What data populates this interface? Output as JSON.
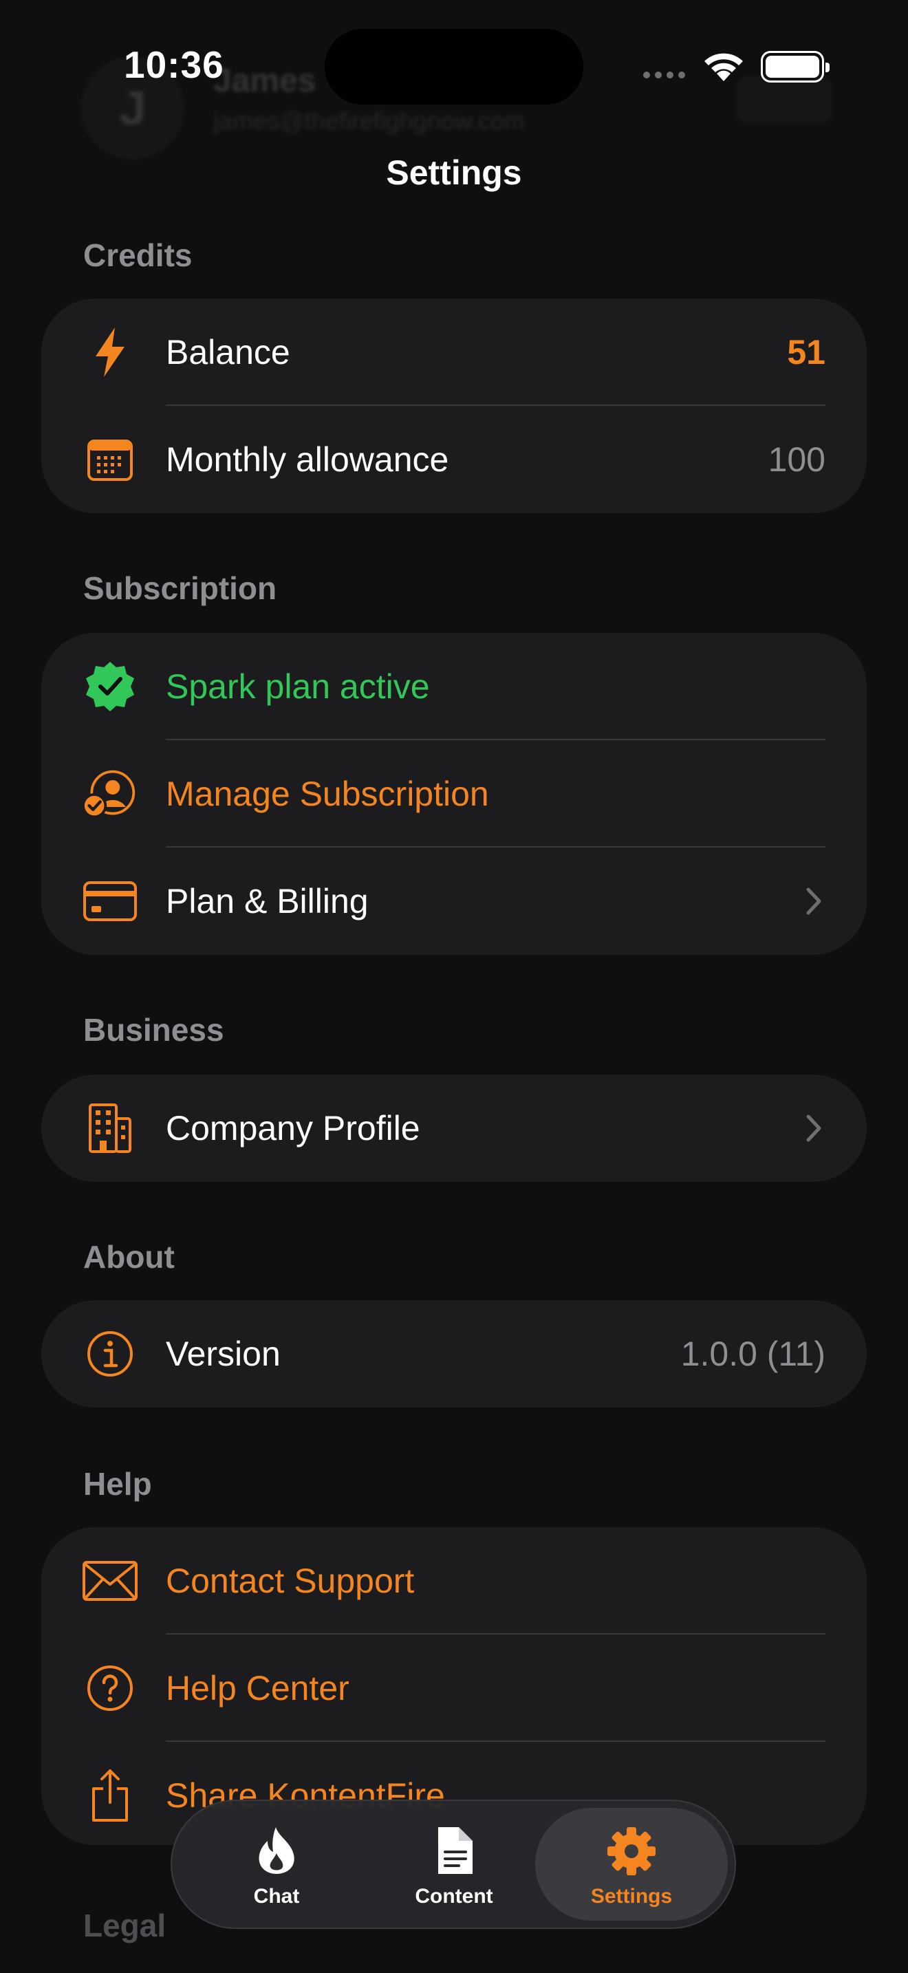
{
  "status_bar": {
    "time": "10:36",
    "ghost_avatar_initial": "J",
    "ghost_name": "James",
    "ghost_email": "james@thefirefighgnow.com"
  },
  "nav": {
    "title": "Settings"
  },
  "colors": {
    "accent": "#f5851f",
    "success": "#32c759",
    "secondary_text": "#8e8e93",
    "card": "#1c1c1f"
  },
  "sections": {
    "credits": {
      "header": "Credits",
      "balance": {
        "label": "Balance",
        "value": "51",
        "icon": "bolt-icon"
      },
      "monthly": {
        "label": "Monthly allowance",
        "value": "100",
        "icon": "calendar-icon"
      }
    },
    "subscription": {
      "header": "Subscription",
      "plan": {
        "label": "Spark plan active",
        "icon": "checkmark-seal-icon"
      },
      "manage": {
        "label": "Manage Subscription",
        "icon": "person-check-icon"
      },
      "billing": {
        "label": "Plan & Billing",
        "icon": "credit-card-icon"
      }
    },
    "business": {
      "header": "Business",
      "company": {
        "label": "Company Profile",
        "icon": "building-icon"
      }
    },
    "about": {
      "header": "About",
      "version": {
        "label": "Version",
        "value": "1.0.0 (11)",
        "icon": "info-icon"
      }
    },
    "help": {
      "header": "Help",
      "contact": {
        "label": "Contact Support",
        "icon": "envelope-icon"
      },
      "help_center": {
        "label": "Help Center",
        "icon": "question-icon"
      },
      "share": {
        "label": "Share KontentFire",
        "icon": "share-icon"
      }
    },
    "legal": {
      "header": "Legal"
    }
  },
  "tabs": [
    {
      "label": "Chat",
      "icon": "flame-icon",
      "active": false
    },
    {
      "label": "Content",
      "icon": "document-icon",
      "active": false
    },
    {
      "label": "Settings",
      "icon": "gear-icon",
      "active": true
    }
  ]
}
